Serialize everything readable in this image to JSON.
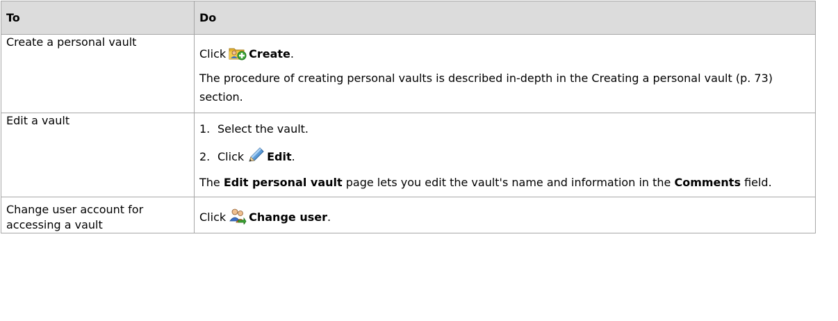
{
  "table": {
    "headers": {
      "to": "To",
      "do": "Do"
    },
    "row_create": {
      "to": "Create a personal vault",
      "click": "Click",
      "action": "Create",
      "period": ".",
      "description": "The procedure of creating personal vaults is described in-depth in the Creating a personal vault (p. 73) section.",
      "icon": "create-vault-icon"
    },
    "row_edit": {
      "to": "Edit a vault",
      "step1_num": "1.",
      "step1_text": "Select the vault.",
      "step2_num": "2.",
      "step2_click": "Click",
      "step2_action": "Edit",
      "step2_period": ".",
      "desc_pre": "The",
      "desc_bold1": "Edit personal vault",
      "desc_mid": "page lets you edit the vault's name and information in the",
      "desc_bold2": "Comments",
      "desc_post": "field.",
      "icon": "pencil-icon"
    },
    "row_change": {
      "to": "Change user account for accessing a vault",
      "click": "Click",
      "action": "Change user",
      "period": ".",
      "icon": "change-user-icon"
    }
  }
}
